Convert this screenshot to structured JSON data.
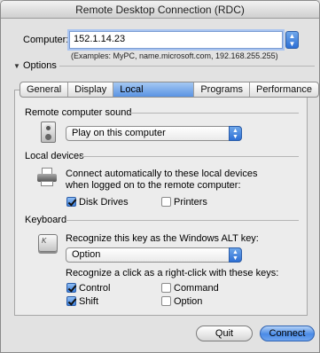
{
  "window": {
    "title": "Remote Desktop Connection (RDC)"
  },
  "computer": {
    "label": "Computer:",
    "value": "152.1.14.23",
    "examples": "(Examples: MyPC, name.microsoft.com, 192.168.255.255)"
  },
  "options": {
    "label": "Options"
  },
  "tabs": [
    {
      "label": "General"
    },
    {
      "label": "Display"
    },
    {
      "label": "Local Resources",
      "active": true
    },
    {
      "label": "Programs"
    },
    {
      "label": "Performance"
    }
  ],
  "sound": {
    "section": "Remote computer sound",
    "selected": "Play on this computer",
    "icon": "speaker-icon"
  },
  "devices": {
    "section": "Local devices",
    "description_line1": "Connect automatically to these local devices",
    "description_line2": "when logged on to the remote computer:",
    "icon": "printer-icon",
    "disk_drives": {
      "label": "Disk Drives",
      "checked": true
    },
    "printers": {
      "label": "Printers",
      "checked": false
    }
  },
  "keyboard": {
    "section": "Keyboard",
    "icon": "key-icon",
    "alt_prompt": "Recognize this key as the Windows ALT key:",
    "alt_selected": "Option",
    "rightclick_prompt": "Recognize a click as a right-click with these keys:",
    "control": {
      "label": "Control",
      "checked": true
    },
    "command": {
      "label": "Command",
      "checked": false
    },
    "shift": {
      "label": "Shift",
      "checked": true
    },
    "option": {
      "label": "Option",
      "checked": false
    }
  },
  "buttons": {
    "quit": "Quit",
    "connect": "Connect"
  },
  "colors": {
    "accent": "#3f82df",
    "window_bg": "#e2e2e2"
  }
}
